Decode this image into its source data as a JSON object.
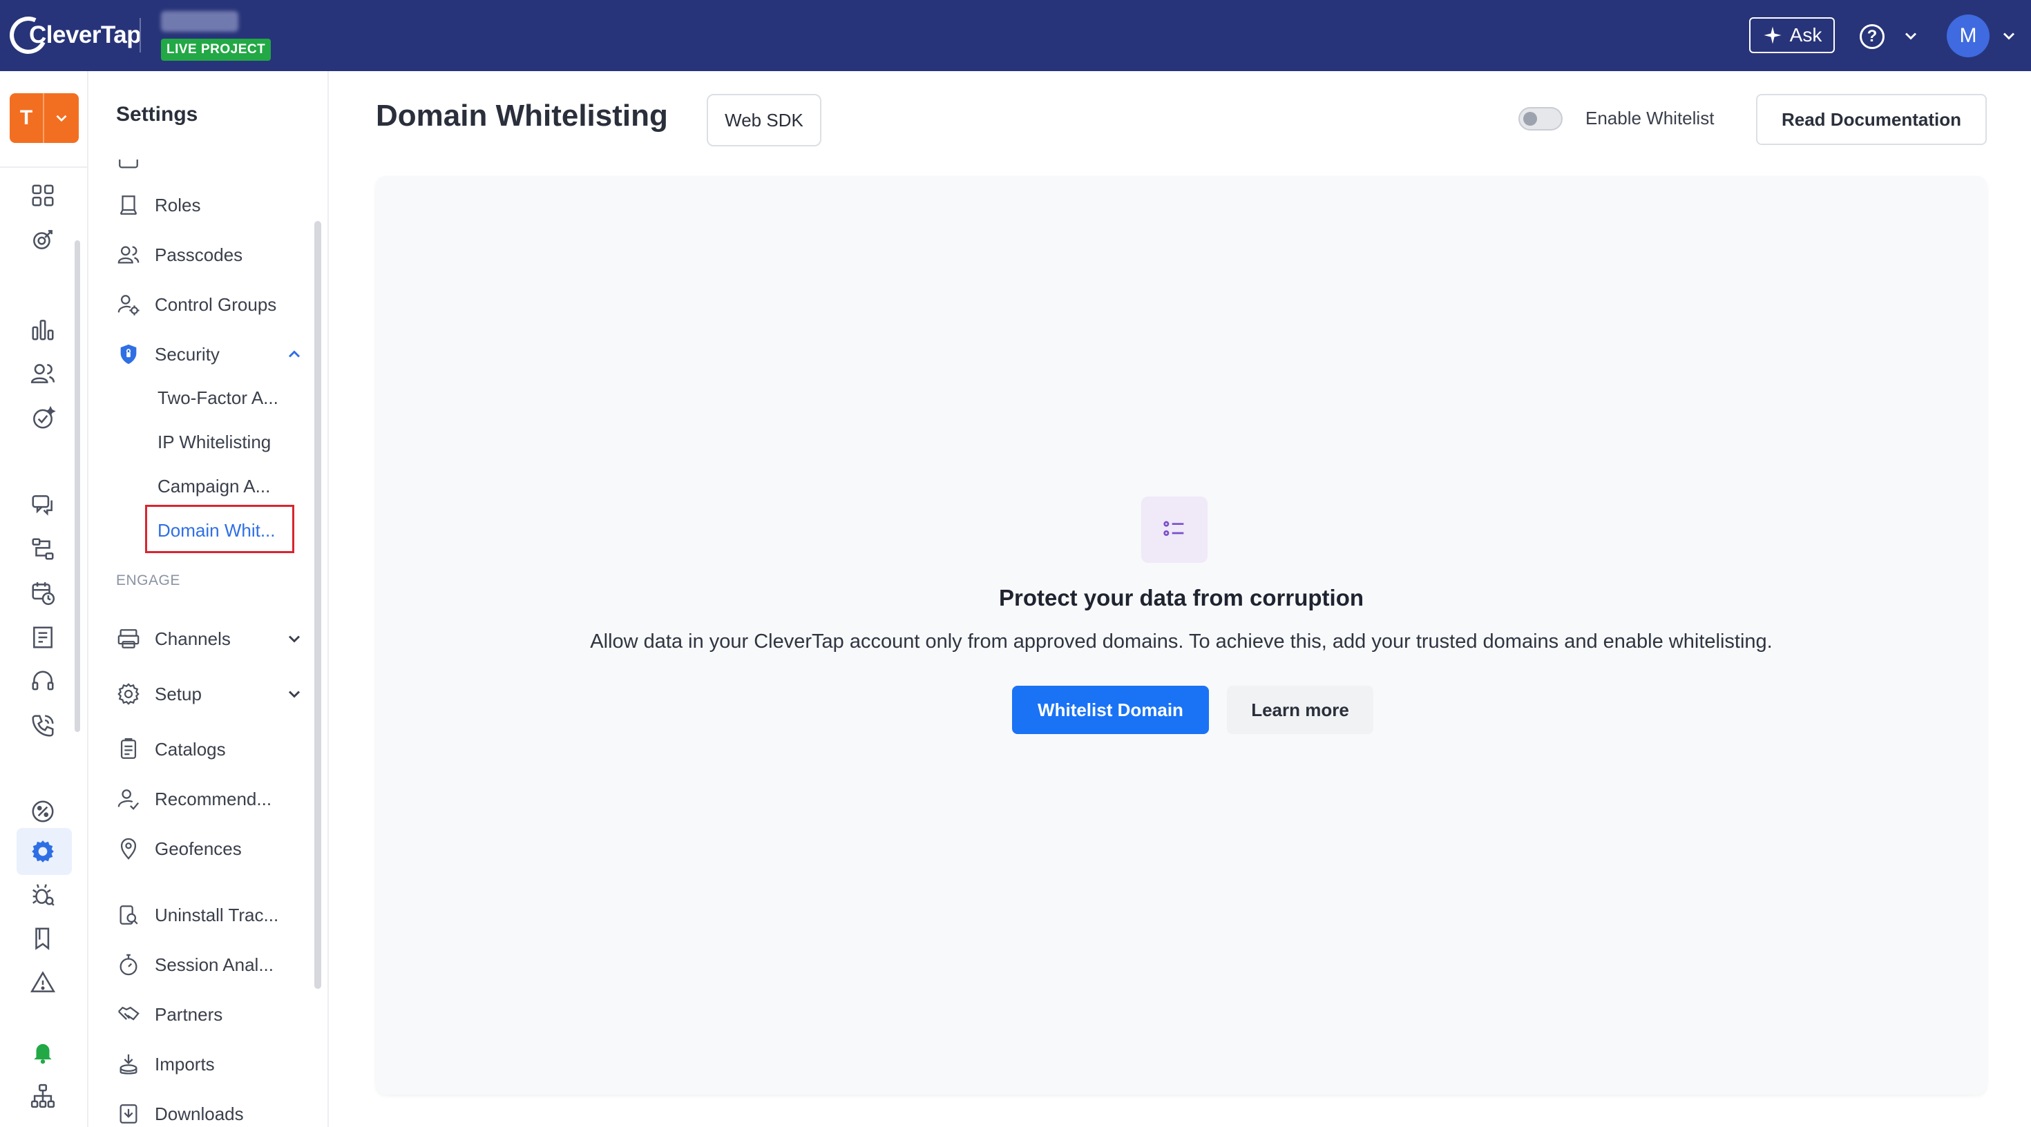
{
  "header": {
    "logo_text": "CleverTap",
    "project_badge": "LIVE PROJECT",
    "ask_label": "Ask",
    "avatar_initial": "M"
  },
  "rail": {
    "tenant_initial": "T",
    "icons": [
      "dashboard-grid-icon",
      "target-icon",
      "analytics-bars-icon",
      "segments-users-icon",
      "insights-icon",
      "messages-icon",
      "journeys-icon",
      "campaign-schedule-icon",
      "catalog-icon",
      "support-headset-icon",
      "call-icon",
      "usage-icon",
      "settings-gear-icon",
      "debug-bug-icon",
      "bookmark-icon",
      "warning-icon",
      "notification-bell-icon",
      "org-hierarchy-icon"
    ],
    "active_color": "#2f6fe4"
  },
  "sidebar": {
    "title": "Settings",
    "items": {
      "roles": "Roles",
      "passcodes": "Passcodes",
      "control_groups": "Control Groups",
      "security": "Security",
      "channels": "Channels",
      "setup": "Setup",
      "catalogs": "Catalogs",
      "recommend": "Recommend...",
      "geofences": "Geofences",
      "uninstall": "Uninstall Trac...",
      "session": "Session Anal...",
      "partners": "Partners",
      "imports": "Imports",
      "downloads": "Downloads"
    },
    "security_sub": {
      "two_factor": "Two-Factor A...",
      "ip_whitelisting": "IP Whitelisting",
      "campaign": "Campaign A...",
      "domain": "Domain Whit..."
    },
    "engage_label": "ENGAGE"
  },
  "main": {
    "title": "Domain Whitelisting",
    "sdk_tag": "Web SDK",
    "toggle_label": "Enable Whitelist",
    "toggle_on": false,
    "doc_button": "Read Documentation",
    "empty": {
      "title": "Protect your data from corruption",
      "description": "Allow data in your CleverTap account only from approved domains. To achieve this, add your trusted domains and enable whitelisting.",
      "primary": "Whitelist Domain",
      "secondary": "Learn more"
    },
    "colors": {
      "header_bg": "#283479",
      "primary": "#1a73f5",
      "live_badge": "#22a845",
      "tenant": "#f26f21",
      "highlight_border": "#d9252f"
    }
  }
}
